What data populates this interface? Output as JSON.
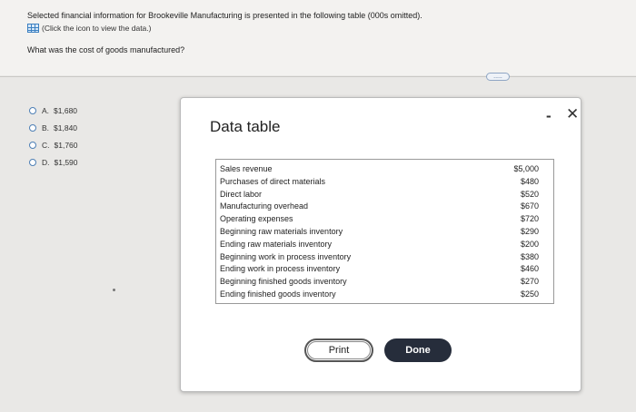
{
  "header": {
    "intro": "Selected financial information for Brookeville Manufacturing is presented in the following table (000s omitted).",
    "icon_hint": "(Click the icon to view the data.)",
    "question": "What was the cost of goods manufactured?",
    "expander_label": "....."
  },
  "options": [
    {
      "letter": "A.",
      "value": "$1,680"
    },
    {
      "letter": "B.",
      "value": "$1,840"
    },
    {
      "letter": "C.",
      "value": "$1,760"
    },
    {
      "letter": "D.",
      "value": "$1,590"
    }
  ],
  "modal": {
    "title": "Data table",
    "minimize_label": "-",
    "close_label": "✕",
    "rows": [
      {
        "label": "Sales revenue",
        "value": "$5,000"
      },
      {
        "label": "Purchases of direct materials",
        "value": "$480"
      },
      {
        "label": "Direct labor",
        "value": "$520"
      },
      {
        "label": "Manufacturing overhead",
        "value": "$670"
      },
      {
        "label": "Operating expenses",
        "value": "$720"
      },
      {
        "label": "Beginning raw materials inventory",
        "value": "$290"
      },
      {
        "label": "Ending raw materials inventory",
        "value": "$200"
      },
      {
        "label": "Beginning work in process inventory",
        "value": "$380"
      },
      {
        "label": "Ending work in process inventory",
        "value": "$460"
      },
      {
        "label": "Beginning finished goods inventory",
        "value": "$270"
      },
      {
        "label": "Ending finished goods inventory",
        "value": "$250"
      }
    ],
    "print_label": "Print",
    "done_label": "Done"
  }
}
